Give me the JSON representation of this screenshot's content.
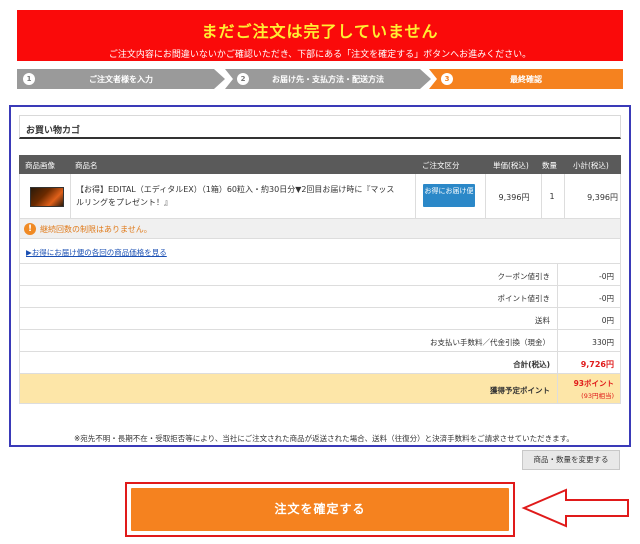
{
  "banner": {
    "title": "まだご注文は完了していません",
    "subtitle": "ご注文内容にお間違いないかご確認いただき、下部にある「注文を確定する」ボタンへお進みください。"
  },
  "steps": [
    {
      "num": "1",
      "label": "ご注文者様を入力"
    },
    {
      "num": "2",
      "label": "お届け先・支払方法・配送方法"
    },
    {
      "num": "3",
      "label": "最終確認"
    }
  ],
  "cart": {
    "title": "お買い物カゴ",
    "headers": {
      "image": "商品画像",
      "name": "商品名",
      "order_type": "ご注文区分",
      "unit_price": "単価(税込)",
      "quantity": "数量",
      "subtotal": "小計(税込)"
    },
    "item": {
      "name": "【お得】EDITAL（エディタルEX）（1箱）60粒入・約30日分▼2回目お届け時に『マッスルリングをプレゼント！』",
      "order_type_button": "お得にお届け便",
      "unit_price": "9,396円",
      "quantity": "1",
      "subtotal": "9,396円"
    },
    "notice": "継続回数の制限はありません。",
    "link": "▶お得にお届け便の各回の商品価格を見る",
    "summary": {
      "coupon_label": "クーポン値引き",
      "coupon_value": "-0円",
      "points_discount_label": "ポイント値引き",
      "points_discount_value": "-0円",
      "shipping_label": "送料",
      "shipping_value": "0円",
      "fee_label": "お支払い手数料／代金引換（現金）",
      "fee_value": "330円",
      "total_label": "合計(税込)",
      "total_value": "9,726円",
      "earned_points_label": "獲得予定ポイント",
      "earned_points_value": "93ポイント",
      "earned_points_sub": "(93円相当)"
    }
  },
  "footnote": "※宛先不明・長期不在・受取拒否等により、当社にご注文された商品が返送された場合、送料（往復分）と決済手数料をご請求させていただきます。",
  "buttons": {
    "change": "商品・数量を変更する",
    "confirm": "注文を確定する"
  },
  "colors": {
    "banner_bg": "#fa0a0a",
    "banner_title": "#ffee33",
    "accent_orange": "#f5821f",
    "cart_border": "#3a3ab8",
    "badge_blue": "#2b88c8",
    "total_red": "#e01a1a"
  },
  "icons": {
    "notice": "exclamation-circle-icon",
    "arrow": "left-arrow-pointer-icon"
  }
}
